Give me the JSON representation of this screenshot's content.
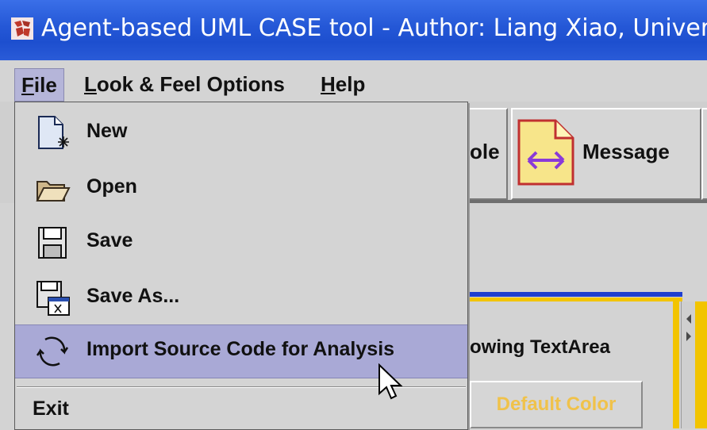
{
  "window": {
    "title": "Agent-based UML CASE tool - Author: Liang Xiao, Univer",
    "icon": "app-logo-icon"
  },
  "menubar": {
    "items": [
      {
        "mnemonic": "F",
        "rest": "ile",
        "active": true
      },
      {
        "mnemonic": "L",
        "rest": "ook & Feel Options",
        "active": false
      },
      {
        "mnemonic": "H",
        "rest": "elp",
        "active": false
      }
    ]
  },
  "file_menu": {
    "items": [
      {
        "label": "New",
        "icon": "new-file-icon"
      },
      {
        "label": "Open",
        "icon": "open-folder-icon"
      },
      {
        "label": "Save",
        "icon": "floppy-disk-icon"
      },
      {
        "label": "Save As...",
        "icon": "save-as-icon"
      },
      {
        "label": "Import Source Code for Analysis",
        "icon": "import-arrows-icon",
        "highlighted": true
      },
      {
        "label": "Exit"
      }
    ]
  },
  "background": {
    "toolbar": {
      "partial_button_label": "ole",
      "message_button_label": "Message"
    },
    "textarea_label": "owing TextArea",
    "color_button_label": "Default Color"
  },
  "colors": {
    "titlebar": "#2457d6",
    "menu_highlight": "#a9a9d6",
    "panel_border_yellow": "#f2c400",
    "divider_blue": "#1f3fd0",
    "default_color_text": "#f0c24a"
  }
}
